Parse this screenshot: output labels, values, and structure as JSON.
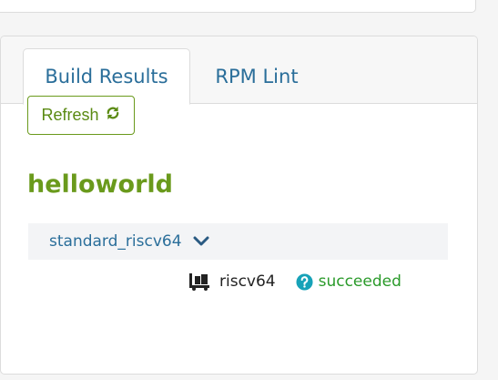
{
  "tabs": [
    {
      "label": "Build Results",
      "active": true
    },
    {
      "label": "RPM Lint",
      "active": false
    }
  ],
  "refresh": {
    "label": "Refresh",
    "icon": "refresh-icon"
  },
  "package": {
    "name": "helloworld"
  },
  "repository": {
    "name": "standard_riscv64",
    "expand_icon": "chevron-down-icon"
  },
  "result": {
    "arch_icon": "dolly-icon",
    "arch": "riscv64",
    "status_icon": "question-circle-icon",
    "status": "succeeded"
  },
  "colors": {
    "link": "#2a6e9a",
    "accent_green": "#6a9a1c",
    "success": "#2a9a2a",
    "info": "#17a2b8"
  }
}
